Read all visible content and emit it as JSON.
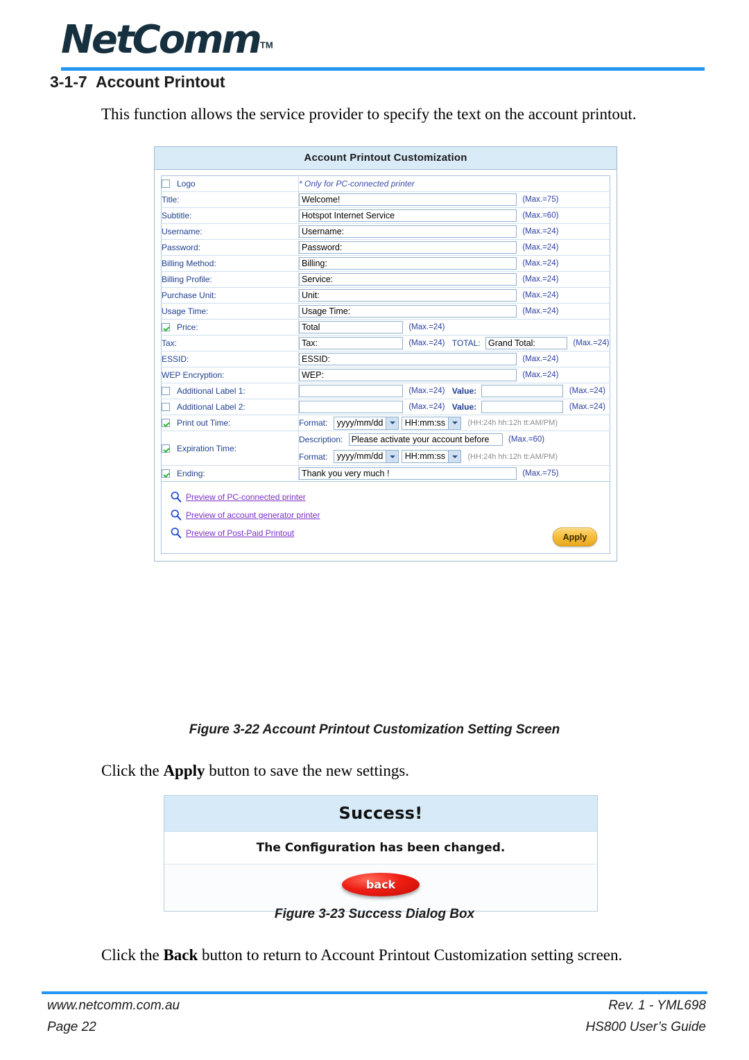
{
  "header": {
    "brand": "NetComm",
    "brand_tm": "TM",
    "section_number": "3-1-7",
    "section_title": "Account Printout",
    "accent_color": "#2196f3"
  },
  "intro_paragraph": "This function allows the service provider to specify the text on the account printout.",
  "screenshot": {
    "panel_title": "Account Printout Customization",
    "rows": [
      {
        "id": "logo",
        "label": "Logo",
        "checkbox": "unchecked",
        "note": "* Only for PC-connected printer"
      },
      {
        "id": "title",
        "label": "Title:",
        "value": "Welcome!",
        "max": "(Max.=75)"
      },
      {
        "id": "subtitle",
        "label": "Subtitle:",
        "value": "Hotspot Internet Service",
        "max": "(Max.=60)"
      },
      {
        "id": "username",
        "label": "Username:",
        "value": "Username:",
        "max": "(Max.=24)"
      },
      {
        "id": "password",
        "label": "Password:",
        "value": "Password:",
        "max": "(Max.=24)"
      },
      {
        "id": "billing-method",
        "label": "Billing Method:",
        "value": "Billing:",
        "max": "(Max.=24)"
      },
      {
        "id": "billing-profile",
        "label": "Billing Profile:",
        "value": "Service:",
        "max": "(Max.=24)"
      },
      {
        "id": "purchase-unit",
        "label": "Purchase Unit:",
        "value": "Unit:",
        "max": "(Max.=24)"
      },
      {
        "id": "usage-time",
        "label": "Usage Time:",
        "value": "Usage Time:",
        "max": "(Max.=24)"
      },
      {
        "id": "price",
        "label": "Price:",
        "checkbox": "checked",
        "value": "Total",
        "max": "(Max.=24)"
      },
      {
        "id": "tax",
        "label": "Tax:",
        "value": "Tax:",
        "max": "(Max.=24)",
        "total_label": "TOTAL:",
        "total_value": "Grand Total:",
        "total_max": "(Max.=24)"
      },
      {
        "id": "essid",
        "label": "ESSID:",
        "value": "ESSID:",
        "max": "(Max.=24)"
      },
      {
        "id": "wep-encryption",
        "label": "WEP Encryption:",
        "value": "WEP:",
        "max": "(Max.=24)"
      },
      {
        "id": "additional-label-1",
        "label": "Additional Label 1:",
        "checkbox": "unchecked",
        "value": "",
        "max": "(Max.=24)",
        "value_label": "Value:",
        "value_value": "",
        "value_max": "(Max.=24)"
      },
      {
        "id": "additional-label-2",
        "label": "Additional Label 2:",
        "checkbox": "unchecked",
        "value": "",
        "max": "(Max.=24)",
        "value_label": "Value:",
        "value_value": "",
        "value_max": "(Max.=24)"
      },
      {
        "id": "print-out-time",
        "label": "Print out Time:",
        "checkbox": "checked",
        "format_label": "Format:",
        "date_format": "yyyy/mm/dd",
        "time_format": "HH:mm:ss",
        "hint": "(HH:24h hh:12h tt:AM/PM)"
      },
      {
        "id": "expiration-time",
        "label": "Expiration Time:",
        "checkbox": "checked",
        "description_label": "Description:",
        "description_value": "Please activate your account before",
        "description_max": "(Max.=60)",
        "format_label": "Format:",
        "date_format": "yyyy/mm/dd",
        "time_format": "HH:mm:ss",
        "hint": "(HH:24h hh:12h tt:AM/PM)"
      },
      {
        "id": "ending",
        "label": "Ending:",
        "checkbox": "checked",
        "value": "Thank you very much !",
        "max": "(Max.=75)"
      }
    ],
    "preview_links": [
      {
        "icon": "magnifier-icon",
        "label": "Preview of PC-connected printer"
      },
      {
        "icon": "magnifier-icon",
        "label": "Preview of account generator printer"
      },
      {
        "icon": "magnifier-icon",
        "label": "Preview of Post-Paid Printout"
      }
    ],
    "apply_button": "Apply",
    "link_color": "#7b2ec8",
    "header_bg": "#d8ebf7",
    "apply_color": "#f6bd3a"
  },
  "figure_22_caption": "Figure 3-22 Account Printout Customization Setting Screen",
  "apply_paragraph": {
    "before": "Click the ",
    "bold": "Apply",
    "after": " button to save the new settings."
  },
  "success_dialog": {
    "title": "Success!",
    "message": "The Configuration has been changed.",
    "back_button": "back",
    "header_bg": "#d6eaf7",
    "button_color": "#ee1d13"
  },
  "figure_23_caption": "Figure 3-23 Success Dialog Box",
  "back_paragraph": {
    "before": "Click the ",
    "bold": "Back",
    "after": " button to return to Account Printout Customization setting screen."
  },
  "footer": {
    "website": "www.netcomm.com.au",
    "page": "Page 22",
    "revision": "Rev. 1 - YML698",
    "guide": "HS800 User’s Guide"
  }
}
